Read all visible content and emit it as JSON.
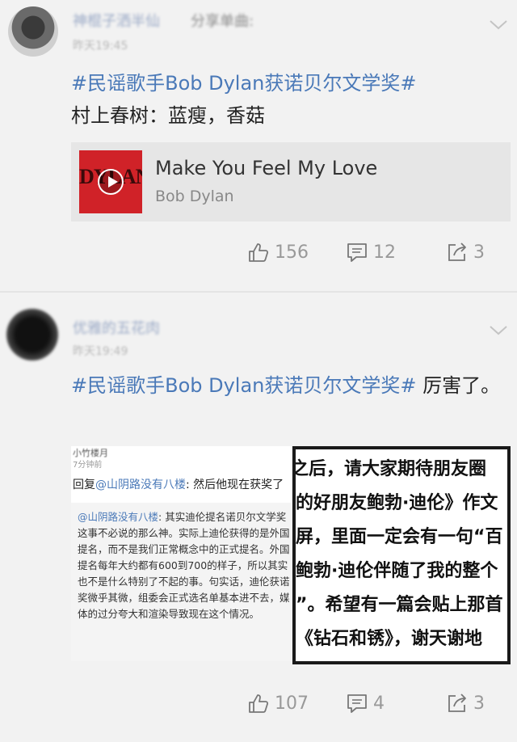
{
  "posts": [
    {
      "username": "神棍子洒半仙",
      "action_label": "分享单曲:",
      "timestamp": "昨天19:45",
      "hashtag": "#民谣歌手Bob Dylan获诺贝尔文学奖#",
      "text": "村上春树：蓝瘦，香菇",
      "music": {
        "album_art_text": "DYLAN",
        "title": "Make You Feel My Love",
        "artist": "Bob Dylan"
      },
      "stats": {
        "likes": "156",
        "comments": "12",
        "shares": "3"
      }
    },
    {
      "username": "优雅的五花肉",
      "timestamp": "昨天19:49",
      "hashtag": "#民谣歌手Bob Dylan获诺贝尔文学奖#",
      "text_suffix": " 厉害了。",
      "image_left": {
        "user": "小竹楼月",
        "time_ago": "7分钟前",
        "reply_prefix": "回复",
        "reply_mention": "@山阴路没有八楼",
        "reply_text": ": 然后他现在获奖了",
        "quote_mention": "@山阴路没有八楼",
        "quote_text": ": 其实迪伦提名诺贝尔文学奖这事不必说的那么神。实际上迪伦获得的是外国提名，而不是我们正常概念中的正式提名。外国提名每年大约都有600到700的样子，所以其实也不是什么特别了不起的事。句实话，迪伦获诺奖微乎其微，组委会正式选名单基本进不去，媒体的过分夸大和渲染导致现在这个情况。"
      },
      "image_right": {
        "lines": [
          "之后，请大家期待朋友圈",
          "的好朋友鲍勃·迪伦》作文",
          "屏，里面一定会有一句“百",
          "鲍勃·迪伦伴随了我的整个",
          "”。希望有一篇会贴上那首",
          "《钻石和锈》，谢天谢地"
        ]
      },
      "stats": {
        "likes": "107",
        "comments": "4",
        "shares": "3"
      }
    }
  ],
  "colors": {
    "link": "#4a79b8",
    "muted": "#999999",
    "background": "#f2f2f2"
  }
}
